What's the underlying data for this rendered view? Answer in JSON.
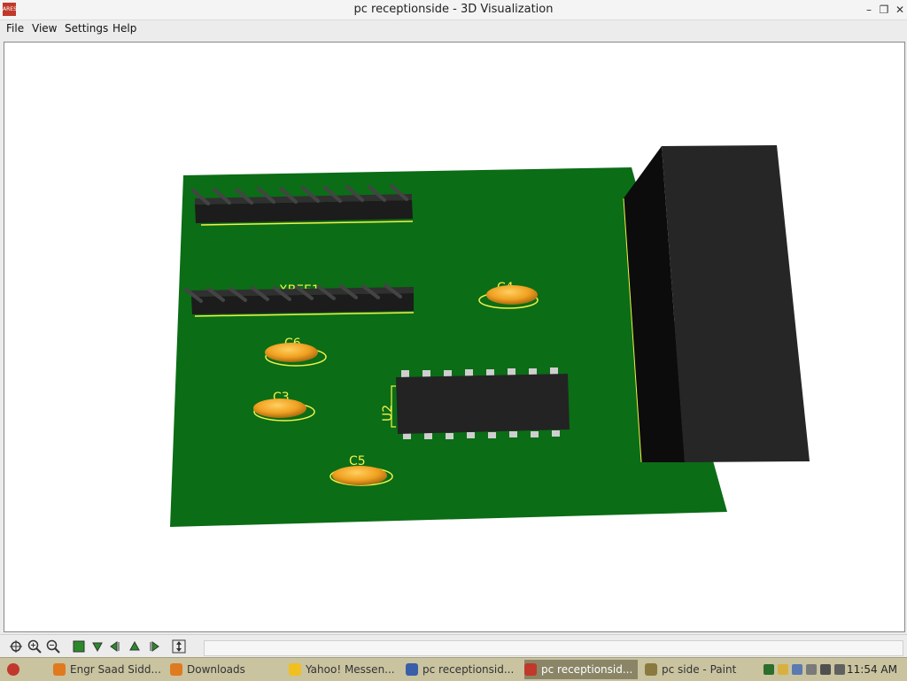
{
  "window": {
    "title": "pc receptionside - 3D Visualization",
    "app_icon_text": "ARES"
  },
  "menu": [
    "File",
    "View",
    "Settings",
    "Help"
  ],
  "scene": {
    "labels": {
      "xbee": "XBEE1",
      "c4": "C4",
      "c6": "C6",
      "c3": "C3",
      "c5": "C5",
      "u2": "U2"
    },
    "colors": {
      "board": "#0b6d16",
      "silk": "#f2f24a",
      "capacitor": "#f0a020",
      "ic": "#262626",
      "connector": "#222222"
    }
  },
  "toolbar": {
    "icons": [
      "pan-icon",
      "zoom-in-icon",
      "zoom-out-icon",
      "view-board-icon",
      "view-down-icon",
      "rotate-left-icon",
      "view-up-icon",
      "rotate-right-icon",
      "toggle-icon"
    ]
  },
  "taskbar": {
    "items": [
      {
        "label": "Engr Saad Sidd...",
        "color": "#e07a1f"
      },
      {
        "label": "Downloads",
        "color": "#e07a1f"
      },
      {
        "label": "Yahoo! Messen...",
        "color": "#f0c020"
      },
      {
        "label": "pc receptionsid...",
        "color": "#3b5ea8"
      },
      {
        "label": "pc receptionsid...",
        "color": "#c0392b"
      },
      {
        "label": "pc side - Paint",
        "color": "#8a7a40"
      }
    ],
    "clock": "11:54 AM"
  }
}
